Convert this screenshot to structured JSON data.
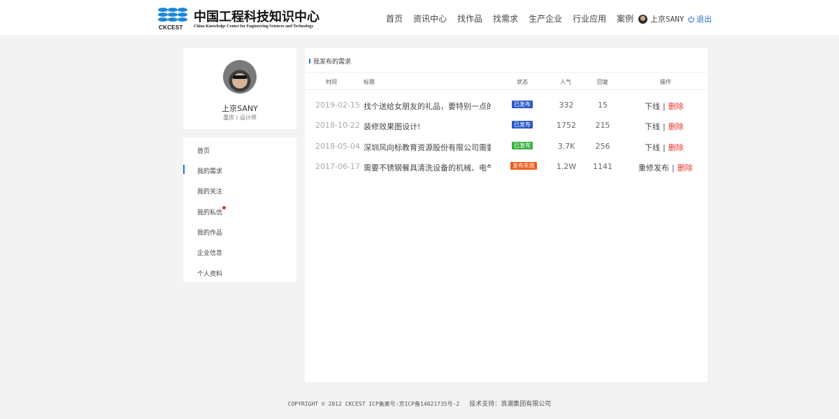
{
  "header": {
    "logo_cn": "中国工程科技知识中心",
    "logo_en": "China Knowledge Centre for Engineering Sciences and Technology",
    "logo_abbr": "CKCEST",
    "nav": [
      "首页",
      "资讯中心",
      "找作品",
      "找需求",
      "生产企业",
      "行业应用",
      "案例"
    ],
    "user_name": "上京SANY",
    "logout": "退出"
  },
  "profile": {
    "name": "上京SANY",
    "subtitle": "重庆 / 设计师"
  },
  "menu": {
    "items": [
      "首页",
      "我的需求",
      "我的关注",
      "我的私信",
      "我的作品",
      "企业信息",
      "个人资料"
    ]
  },
  "panel": {
    "title": "我发布的需求",
    "columns": [
      "时间",
      "标题",
      "状态",
      "人气",
      "回复",
      "操作"
    ],
    "rows": [
      {
        "time": "2019-02-15",
        "title": "找个送给女朋友的礼品，要特别一点的!",
        "status": "已发布",
        "status_color": "#2b58c9",
        "popularity": "332",
        "replies": "15",
        "op1": "下线",
        "sep": "|",
        "op2": "删除"
      },
      {
        "time": "2018-10-22",
        "title": "装修效果图设计!",
        "status": "已发布",
        "status_color": "#2b58c9",
        "popularity": "1752",
        "replies": "215",
        "op1": "下线",
        "sep": "|",
        "op2": "删除"
      },
      {
        "time": "2018-05-04",
        "title": "深圳风向标教育资源股份有限公司需要...",
        "status": "已发布",
        "status_color": "#3cb043",
        "popularity": "3.7K",
        "replies": "256",
        "op1": "下线",
        "sep": "|",
        "op2": "删除"
      },
      {
        "time": "2017-06-17",
        "title": "需要不锈钢餐具清洗设备的机械、电气...",
        "status": "发布失败",
        "status_color": "#f05a16",
        "popularity": "1.2W",
        "replies": "1141",
        "op1": "重修发布",
        "sep": "|",
        "op2": "删除"
      }
    ]
  },
  "footer": {
    "copyright": "COPYRIGHT © 2012 CKCEST ICP备案号:京ICP备14021735号-2",
    "support": "技术支持：浪潮集团有限公司"
  },
  "colors": {
    "accent": "#2b6fcf",
    "danger": "#e8342c",
    "background": "#f3f3f3"
  }
}
